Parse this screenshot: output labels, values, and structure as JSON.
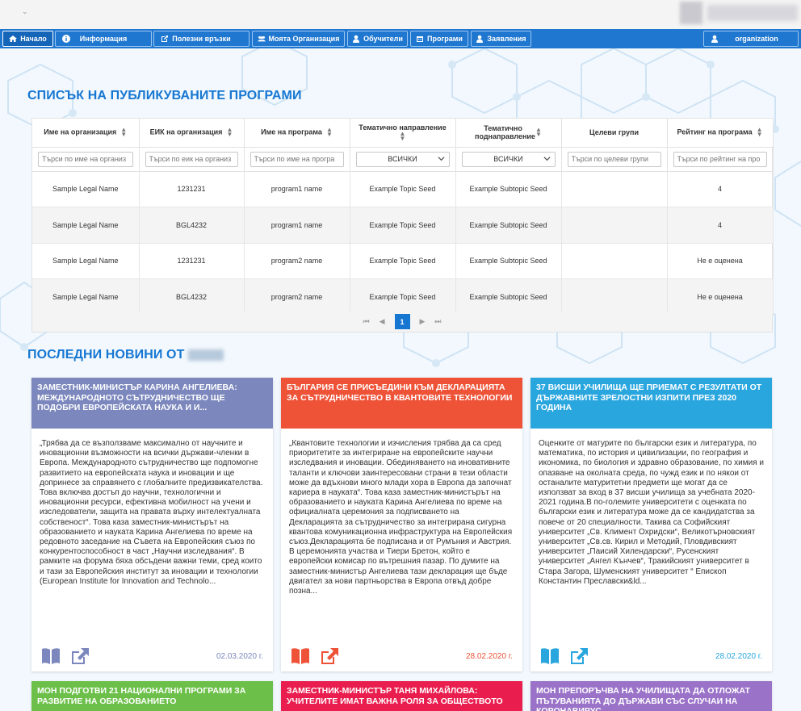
{
  "nav": {
    "items": [
      {
        "label": "Начало",
        "icon": "home-icon"
      },
      {
        "label": "Информация",
        "icon": "info-icon"
      },
      {
        "label": "Полезни връзки",
        "icon": "external-link-icon"
      },
      {
        "label": "Моята Организация",
        "icon": "users-icon"
      },
      {
        "label": "Обучители",
        "icon": "user-icon"
      },
      {
        "label": "Програми",
        "icon": "calendar-icon"
      },
      {
        "label": "Заявления",
        "icon": "user-icon"
      }
    ],
    "account": "organization"
  },
  "programs": {
    "title": "СПИСЪК НА ПУБЛИКУВАНИТЕ ПРОГРАМИ",
    "columns": [
      "Име на организация",
      "ЕИК на организация",
      "Име на програма",
      "Тематично направление",
      "Тематично поднаправление",
      "Целеви групи",
      "Рейтинг на програма"
    ],
    "filters": [
      {
        "type": "input",
        "placeholder": "Търси по име на организ"
      },
      {
        "type": "input",
        "placeholder": "Търси по еик на организ"
      },
      {
        "type": "input",
        "placeholder": "Търси по име на програ"
      },
      {
        "type": "select",
        "value": "ВСИЧКИ"
      },
      {
        "type": "select",
        "value": "ВСИЧКИ"
      },
      {
        "type": "input",
        "placeholder": "Търси по целеви групи"
      },
      {
        "type": "input",
        "placeholder": "Търси по рейтинг на про"
      }
    ],
    "rows": [
      [
        "Sample Legal Name",
        "1231231",
        "program1 name",
        "Example Topic Seed",
        "Example Subtopic Seed",
        "",
        "4"
      ],
      [
        "Sample Legal Name",
        "BGL4232",
        "program1 name",
        "Example Topic Seed",
        "Example Subtopic Seed",
        "",
        "4"
      ],
      [
        "Sample Legal Name",
        "1231231",
        "program2 name",
        "Example Topic Seed",
        "Example Subtopic Seed",
        "",
        "Не е оценена"
      ],
      [
        "Sample Legal Name",
        "BGL4232",
        "program2 name",
        "Example Topic Seed",
        "Example Subtopic Seed",
        "",
        "Не е оценена"
      ]
    ],
    "pager": {
      "first": "⏮",
      "prev": "◀",
      "current": "1",
      "next": "▶",
      "last": "⏭"
    }
  },
  "news": {
    "title": "ПОСЛЕДНИ НОВИНИ ОТ",
    "cards": [
      {
        "color": "#7b87bd",
        "title": "ЗАМЕСТНИК-МИНИСТЪР КАРИНА АНГЕЛИЕВА: МЕЖДУНАРОДНОТО СЪТРУДНИЧЕСТВО ЩЕ ПОДОБРИ ЕВРОПЕЙСКАТА НАУКА И И...",
        "body": "„Трябва да се възползваме максимално от научните и иновационни възможности на всички държави-членки в Европа. Международното сътрудничество ще подпомогне развитието на европейската наука и иновации и ще допринесе за справянето с глобалните предизвикателства. Това включва достъп до научни, технологични и иновационни ресурси, ефективна мобилност на учени и изследователи, защита на правата върху интелектуалната собственост“. Това каза заместник-министърът на образованието и науката Карина Ангелиева по време на редовното заседание на Съвета на Европейския съюз по конкурентоспособност в част „Научни изследвания“. В рамките на форума бяха обсъдени важни теми, сред които и тази за Европейския институт за иновации и технологии (European Institute for Innovation and Technolo...",
        "date": "02.03.2020 г."
      },
      {
        "color": "#ee5237",
        "title": "БЪЛГАРИЯ СЕ ПРИСЪЕДИНИ КЪМ ДЕКЛАРАЦИЯТА ЗА СЪТРУДНИЧЕСТВО В КВАНТОВИТЕ ТЕХНОЛОГИИ",
        "body": "„Квантовите технологии и изчисления трябва да са сред приоритетите за интегриране на европейските научни изследвания и иновации. Обединяването на иновативните таланти и ключови заинтересовани страни в тези области може да вдъхнови много млади хора в Европа да започнат кариера в науката“. Това каза заместник-министърът на образованието и науката Карина Ангелиева по време на официалната церемония за подписването на Декларацията за сътрудничество за интегрирана сигурна квантова комуникационна инфраструктура на Европейския съюз.Декларацията бе подписана и от Румъния и Австрия. В церемонията участва и Тиери Бретон, който е европейски комисар по вътрешния пазар. По думите на заместник-министър Ангелиева тази декларация ще бъде двигател за нови партньорства в Европа отвъд добре позна...",
        "date": "28.02.2020 г."
      },
      {
        "color": "#2aa6df",
        "title": "37 ВИСШИ УЧИЛИЩА ЩЕ ПРИЕМАТ С РЕЗУЛТАТИ ОТ ДЪРЖАВНИТЕ ЗРЕЛОСТНИ ИЗПИТИ ПРЕЗ 2020 ГОДИНА",
        "body": "Оценките от матурите по български език и литература, по математика, по история и цивилизации, по география и икономика, по биология и здравно образование, по химия и опазване на околната среда, по чужд език и по някои от останалите матуритетни предмети ще могат да се използват за вход в 37 висши училища за учебната 2020-2021 година.В по-големите университети с оценката по български език и литература може да се кандидатства за повече от 20 специалности. Такива са Софийският университет „Св. Климент Охридски“, Великотърновският университет „Св.св. Кирил и Методий, Пловдивският университет „Паисий Хилендарски“, Русенският университет „Ангел Кънчев“, Тракийският университет в Стара Загора, Шуменският университет “ Епископ Константин Преславски&ld...",
        "date": "28.02.2020 г."
      },
      {
        "color": "#6cc04a",
        "title": "МОН ПОДГОТВИ 21 НАЦИОНАЛНИ ПРОГРАМИ ЗА РАЗВИТИЕ НА ОБРАЗОВАНИЕТО"
      },
      {
        "color": "#e91e4f",
        "title": "ЗАМЕСТНИК-МИНИСТЪР ТАНЯ МИХАЙЛОВА: УЧИТЕЛИТЕ ИМАТ ВАЖНА РОЛЯ ЗА ОБЩЕСТВОТО"
      },
      {
        "color": "#9a73c9",
        "title": "МОН ПРЕПОРЪЧВА НА УЧИЛИЩАТА ДА ОТЛОЖАТ ПЪТУВАНИЯТА ДО ДЪРЖАВИ СЪС СЛУЧАИ НА КОРОНАВИРУС"
      }
    ]
  }
}
